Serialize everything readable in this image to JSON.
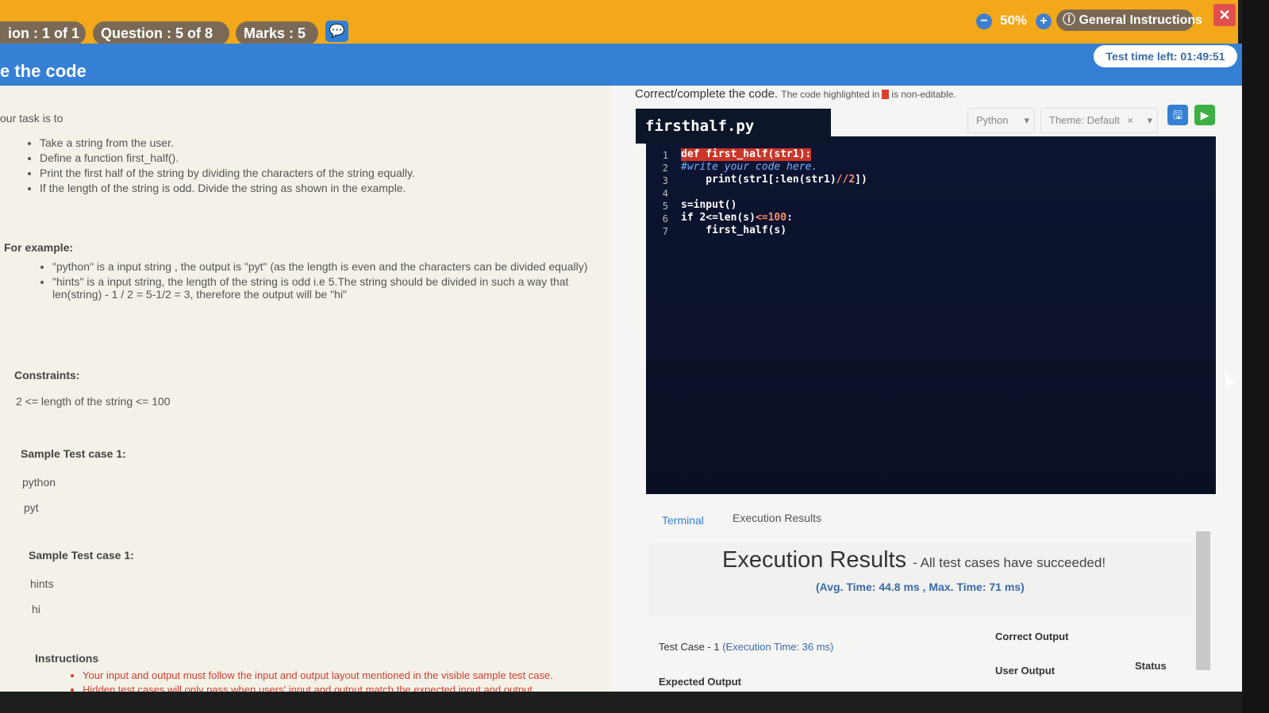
{
  "header": {
    "section": "ion : 1 of 1",
    "question": "Question : 5 of 8",
    "marks": "Marks : 5",
    "zoom": "50%",
    "general_instructions": "General Instructions",
    "close": "✕"
  },
  "titlebar": {
    "title": "e the code",
    "timer": "Test time left: 01:49:51"
  },
  "problem": {
    "intro": "our task is to",
    "tasks": [
      "Take a string from the user.",
      "Define a function first_half().",
      "Print the first half of the string by dividing the characters of the string equally.",
      "If the length of the string is odd. Divide the string as shown in the example."
    ],
    "example_heading": "For example:",
    "example1": "\"python\" is a input string , the output is \"pyt\" (as the length is even and the characters can be divided equally)",
    "example2": "\"hints\" is a input string, the length of the string is odd i.e 5.The string should be divided in such a way that len(string) - 1 / 2 = 5-1/2 = 3, therefore the output will be \"hi\"",
    "constraints_heading": "Constraints:",
    "constraint": "2 <= length of the string <= 100",
    "sample1_heading": "Sample Test case 1:",
    "sample1_input": "python",
    "sample1_output": "pyt",
    "sample2_heading": "Sample Test case 1:",
    "sample2_input": "hints",
    "sample2_output": "hi",
    "instructions_heading": "Instructions",
    "instructions": [
      "Your input and output must follow the input and output layout mentioned in the visible sample test case.",
      "Hidden test cases will only pass when users' input and output match the expected input and output."
    ]
  },
  "editor": {
    "caption": "Correct/complete the code.",
    "caption_note_pre": "The code highlighted in",
    "caption_note_post": "is non-editable.",
    "filename": "firsthalf.py",
    "language": "Python",
    "theme": "Theme: Default",
    "line_numbers": [
      "1",
      "2",
      "3",
      "4",
      "5",
      "6",
      "7"
    ],
    "lines": {
      "l1": "def first_half(str1):",
      "l2": "#write your code here.",
      "l3a": "    print(str1[:len(str1)",
      "l3b": "//2",
      "l3c": "])",
      "l5": "s=input()",
      "l6a": "if 2<=len(s)",
      "l6b": "<=100",
      "l6c": ":",
      "l7": "    first_half(s)"
    }
  },
  "results": {
    "tab_terminal": "Terminal",
    "tab_execution": "Execution Results",
    "title": "Execution Results",
    "subtitle": "- All test cases have succeeded!",
    "timing": "(Avg. Time: 44.8 ms , Max. Time: 71 ms)",
    "test_case": "Test Case - 1",
    "test_time": "(Execution Time: 36 ms)",
    "correct_output": "Correct Output",
    "expected_output": "Expected Output",
    "user_output": "User Output",
    "status": "Status"
  }
}
